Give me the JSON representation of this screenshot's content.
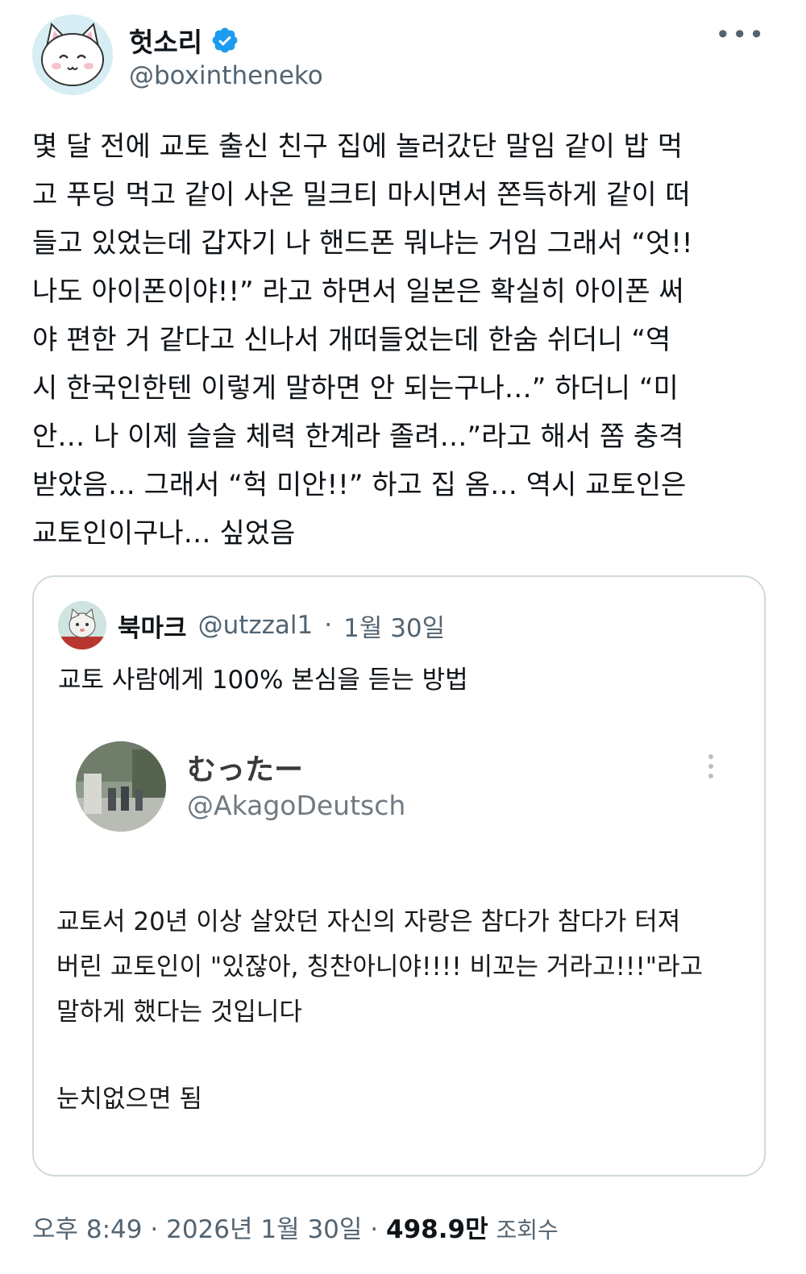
{
  "author": {
    "display_name": "헛소리",
    "handle": "@boxintheneko",
    "avatar_icon": "white-cat-avatar-icon",
    "verified_icon": "verified-badge-icon",
    "verified_color": "#1d9bf0"
  },
  "more_icon": "•••",
  "tweet": {
    "lines": [
      "몇 달 전에 교토 출신 친구 집에 놀러갔단 말임 같이 밥 먹",
      "고 푸딩 먹고 같이 사온 밀크티 마시면서 쫀득하게 같이 떠",
      "들고 있었는데 갑자기 나 핸드폰 뭐냐는 거임 그래서 “엇!!",
      "나도 아이폰이야!!” 라고 하면서 일본은 확실히 아이폰 써",
      "야 편한 거 같다고 신나서 개떠들었는데 한숨 쉬더니 “역",
      "시 한국인한텐 이렇게 말하면 안 되는구나…” 하더니 “미",
      "안… 나 이제 슬슬 체력 한계라 졸려…”라고 해서 쫌 충격",
      "받았음… 그래서 “헉 미안!!” 하고 집 옴… 역시 교토인은",
      "교토인이구나… 싶었음"
    ]
  },
  "quote": {
    "display_name": "북마크",
    "handle": "@utzzal1",
    "dot": "·",
    "date": "1월 30일",
    "text": "교토 사람에게 100% 본심을 듣는 방법",
    "embedded": {
      "name": "むったー",
      "handle": "@AkagoDeutsch",
      "body_lines": [
        "교토서 20년 이상 살았던 자신의 자랑은 참다가 참다가 터져",
        "버린 교토인이 \"있잖아, 칭찬아니야!!!! 비꼬는 거라고!!!\"라고",
        "말하게 했다는 것입니다"
      ],
      "last_line": "눈치없으면 됨"
    }
  },
  "meta": {
    "time": "오후 8:49",
    "dot1": "·",
    "date": "2026년 1월 30일",
    "dot2": "·",
    "views": "498.9만",
    "views_label": "조회수"
  }
}
